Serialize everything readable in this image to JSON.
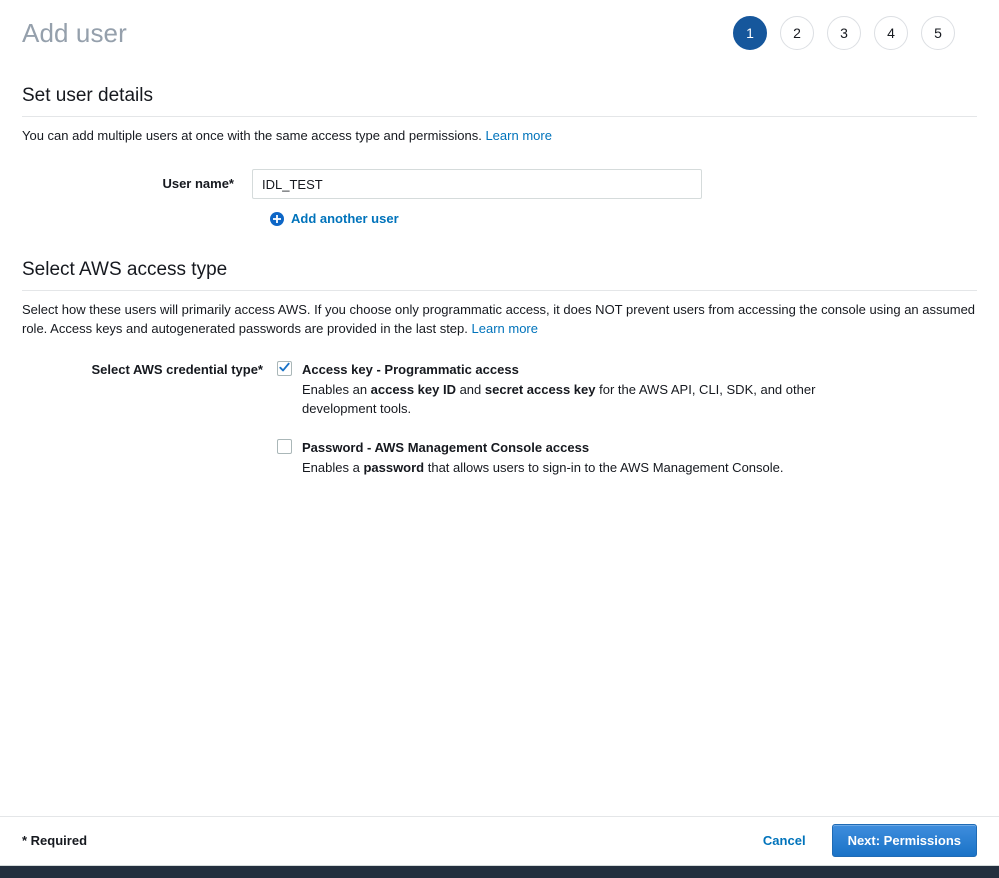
{
  "header": {
    "title": "Add user",
    "steps": [
      {
        "number": "1",
        "active": true
      },
      {
        "number": "2",
        "active": false
      },
      {
        "number": "3",
        "active": false
      },
      {
        "number": "4",
        "active": false
      },
      {
        "number": "5",
        "active": false
      }
    ]
  },
  "user_details": {
    "heading": "Set user details",
    "description": "You can add multiple users at once with the same access type and permissions.",
    "learn_more": "Learn more",
    "username_label": "User name*",
    "username_value": "IDL_TEST",
    "username_placeholder": "",
    "add_another_label": "Add another user",
    "add_another_icon": "plus-circle-icon"
  },
  "access_type": {
    "heading": "Select AWS access type",
    "description_part1": "Select how these users will primarily access AWS. If you choose only programmatic access, it does NOT prevent users from accessing the console using an assumed role. Access keys and autogenerated passwords are provided in the last step.",
    "learn_more": "Learn more",
    "credential_label": "Select AWS credential type*",
    "options": [
      {
        "title": "Access key - Programmatic access",
        "checked": true,
        "desc_1": "Enables an ",
        "desc_bold_1": "access key ID",
        "desc_2": " and ",
        "desc_bold_2": "secret access key",
        "desc_3": " for the AWS API, CLI, SDK, and other development tools."
      },
      {
        "title": "Password - AWS Management Console access",
        "checked": false,
        "desc_1": "Enables a ",
        "desc_bold_1": "password",
        "desc_2": " that allows users to sign-in to the AWS Management Console.",
        "desc_bold_2": "",
        "desc_3": ""
      }
    ]
  },
  "footer": {
    "required_note": "* Required",
    "cancel_label": "Cancel",
    "next_label": "Next: Permissions"
  },
  "colors": {
    "accent_blue": "#0073bb",
    "active_step": "#16579c",
    "button_blue": "#1a73c7",
    "bottom_bar": "#232f3e",
    "title_gray": "#95a0ac"
  }
}
